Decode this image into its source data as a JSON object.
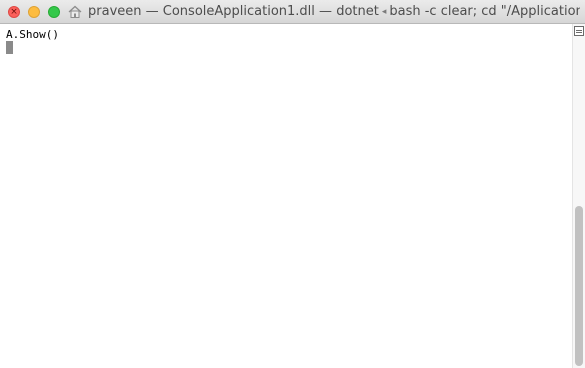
{
  "window": {
    "title_user": "praveen",
    "title_dash1": "—",
    "title_file": "ConsoleApplication1.dll",
    "title_dash2": "—",
    "title_process": "dotnet",
    "title_separator": "◂",
    "title_command": "bash -c clear; cd \"/Applications/Vis..."
  },
  "terminal": {
    "lines": [
      "A.Show()"
    ]
  },
  "icons": {
    "home": "home-folder-icon",
    "split": "split-pane-icon"
  },
  "colors": {
    "close": "#fc605b",
    "minimize": "#fdbc40",
    "zoom": "#34c84a",
    "cursor": "#8a8a8a",
    "scroll_thumb": "#c1c1c1"
  },
  "scrollbar": {
    "thumb_start_fraction": 0.53,
    "thumb_size_fraction": 0.47
  }
}
